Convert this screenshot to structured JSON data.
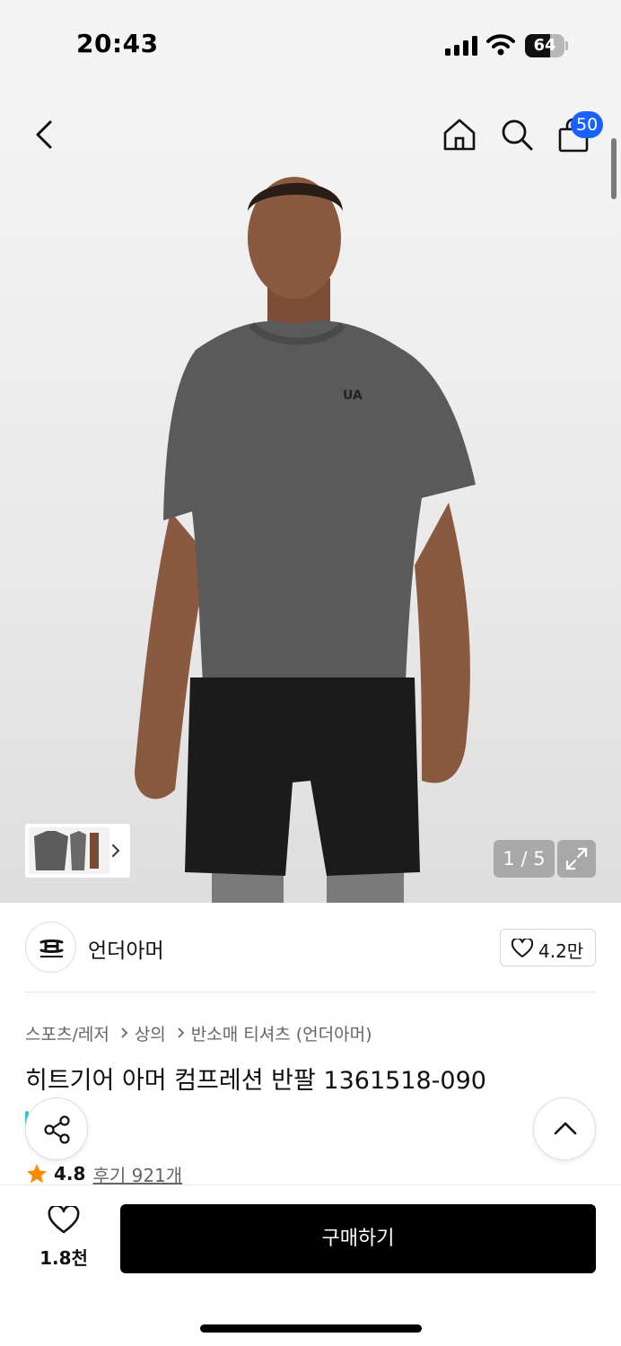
{
  "status_bar": {
    "time": "20:43",
    "battery_level": "64",
    "icons": [
      "signal-icon",
      "wifi-icon",
      "battery-icon"
    ]
  },
  "top_nav": {
    "icons": [
      "back-arrow-icon",
      "home-icon",
      "search-icon",
      "shopping-bag-icon"
    ],
    "cart_count": "50"
  },
  "gallery": {
    "page_indicator": "1 / 5",
    "icons": [
      "chevron-right-icon",
      "expand-icon"
    ]
  },
  "brand": {
    "name": "언더아머",
    "like_count": "4.2만",
    "icons": [
      "under-armour-logo",
      "heart-outline-icon"
    ]
  },
  "breadcrumb": {
    "items": [
      "스포츠/레저",
      "상의",
      "반소매 티셔츠 (언더아머)"
    ]
  },
  "product": {
    "title": "히트기어 아머 컴프레션 반팔 1361518-090",
    "rating": "4.8",
    "reviews_label": "후기 921개"
  },
  "floating": {
    "icons": [
      "share-icon",
      "chevron-up-icon"
    ]
  },
  "bottom_bar": {
    "wish_count": "1.8천",
    "buy_label": "구매하기"
  },
  "colors": {
    "badge": "#1a62ff",
    "star": "#ff8a00",
    "buy_button": "#000000"
  }
}
